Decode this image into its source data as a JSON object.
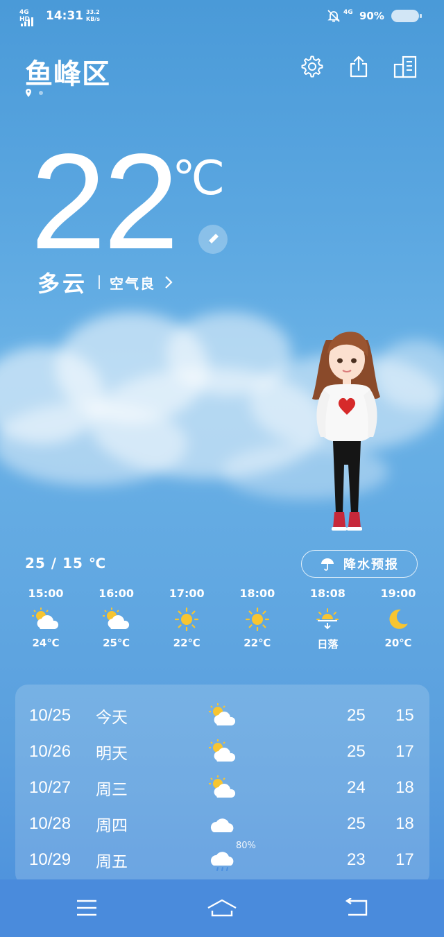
{
  "status_bar": {
    "network_left": "4G HD",
    "time": "14:31",
    "speed": "33.2",
    "speed_unit": "KB/s",
    "network_right": "4G",
    "battery": "90%"
  },
  "header": {
    "city": "鱼峰区"
  },
  "current": {
    "temperature": "22",
    "unit": "℃",
    "condition": "多云",
    "air_quality": "空气良"
  },
  "range": "25 / 15 ℃",
  "precip_label": "降水预报",
  "hourly": [
    {
      "time": "15:00",
      "icon": "partly-cloudy-icon",
      "value": "24℃"
    },
    {
      "time": "16:00",
      "icon": "partly-cloudy-icon",
      "value": "25℃"
    },
    {
      "time": "17:00",
      "icon": "sun-icon",
      "value": "22℃"
    },
    {
      "time": "18:00",
      "icon": "sun-icon",
      "value": "22℃"
    },
    {
      "time": "18:08",
      "icon": "sunset-icon",
      "value": "日落"
    },
    {
      "time": "19:00",
      "icon": "moon-icon",
      "value": "20℃"
    }
  ],
  "daily": [
    {
      "date": "10/25",
      "weekday": "今天",
      "icon": "partly-cloudy-icon",
      "high": "25",
      "low": "15",
      "precip": ""
    },
    {
      "date": "10/26",
      "weekday": "明天",
      "icon": "partly-cloudy-icon",
      "high": "25",
      "low": "17",
      "precip": ""
    },
    {
      "date": "10/27",
      "weekday": "周三",
      "icon": "partly-cloudy-icon",
      "high": "24",
      "low": "18",
      "precip": ""
    },
    {
      "date": "10/28",
      "weekday": "周四",
      "icon": "cloud-icon",
      "high": "25",
      "low": "18",
      "precip": ""
    },
    {
      "date": "10/29",
      "weekday": "周五",
      "icon": "rain-icon",
      "high": "23",
      "low": "17",
      "precip": "80%"
    }
  ],
  "colors": {
    "sun": "#f7c531",
    "cloud": "#ffffff",
    "rain": "#4a8fe0"
  }
}
